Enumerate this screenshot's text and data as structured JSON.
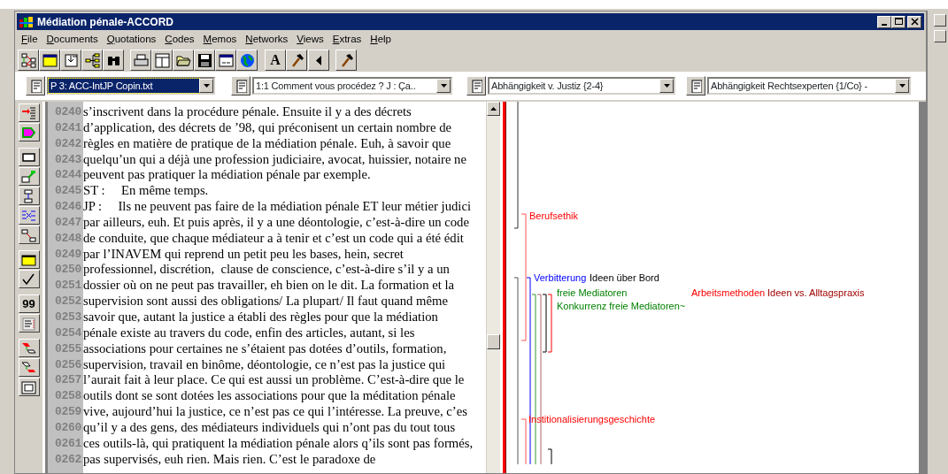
{
  "window": {
    "title": "Médiation pénale-ACCORD"
  },
  "menu": [
    {
      "label": "File"
    },
    {
      "label": "Documents"
    },
    {
      "label": "Quotations"
    },
    {
      "label": "Codes"
    },
    {
      "label": "Memos"
    },
    {
      "label": "Networks"
    },
    {
      "label": "Views"
    },
    {
      "label": "Extras"
    },
    {
      "label": "Help"
    }
  ],
  "toolbar": {
    "font_button": "A"
  },
  "side_toolbar": {
    "quote_button": "99"
  },
  "selectors": [
    {
      "value": "P 3: ACC-IntJP Copin.txt",
      "selected": true
    },
    {
      "value": "1:1 Comment vous procédez ? J : Ça..",
      "selected": false
    },
    {
      "value": "Abhängigkeit v. Justiz {2-4}",
      "selected": false
    },
    {
      "value": "Abhängigkeit Rechtsexperten {1/Co} -",
      "selected": false
    }
  ],
  "lines": [
    {
      "number": "0240",
      "text": "s’inscrivent dans la procédure pénale. Ensuite il y a des décrets"
    },
    {
      "number": "0241",
      "text": "d’application, des décrets de ’98, qui préconisent un certain nombre de"
    },
    {
      "number": "0242",
      "text": "règles en matière de pratique de la médiation pénale. Euh, à savoir que"
    },
    {
      "number": "0243",
      "text": "quelqu’un qui a déjà une profession judiciaire, avocat, huissier, notaire ne"
    },
    {
      "number": "0244",
      "text": "peuvent pas pratiquer la médiation pénale par exemple."
    },
    {
      "number": "0245",
      "text": "ST :     En même temps."
    },
    {
      "number": "0246",
      "text": "JP :     Ils ne peuvent pas faire de la médiation pénale ET leur métier judici"
    },
    {
      "number": "0247",
      "text": "par ailleurs, euh. Et puis après, il y a une déontologie, c’est-à-dire un code"
    },
    {
      "number": "0248",
      "text": "de conduite, que chaque médiateur a à tenir et c’est un code qui a été édit"
    },
    {
      "number": "0249",
      "text": "par l’INAVEM qui reprend un petit peu les bases, hein, secret"
    },
    {
      "number": "0250",
      "text": "professionnel, discrétion,  clause de conscience, c’est-à-dire s’il y a un"
    },
    {
      "number": "0251",
      "text": "dossier où on ne peut pas travailler, eh bien on le dit. La formation et la"
    },
    {
      "number": "0252",
      "text": "supervision sont aussi des obligations/ La plupart/ Il faut quand même"
    },
    {
      "number": "0253",
      "text": "savoir que, autant la justice a établi des règles pour que la médiation"
    },
    {
      "number": "0254",
      "text": "pénale existe au travers du code, enfin des articles, autant, si les"
    },
    {
      "number": "0255",
      "text": "associations pour certaines ne s’étaient pas dotées d’outils, formation,"
    },
    {
      "number": "0256",
      "text": "supervision, travail en binôme, déontologie, ce n’est pas la justice qui"
    },
    {
      "number": "0257",
      "text": "l’aurait fait à leur place. Ce qui est aussi un problème. C’est-à-dire que le"
    },
    {
      "number": "0258",
      "text": "outils dont se sont dotées les associations pour que la méditation pénale"
    },
    {
      "number": "0259",
      "text": "vive, aujourd’hui la justice, ce n’est pas ce qui l’intéresse. La preuve, c’es"
    },
    {
      "number": "0260",
      "text": "qu’il y a des gens, des médiateurs individuels qui n’ont pas du tout tous"
    },
    {
      "number": "0261",
      "text": "ces outils-là, qui pratiquent la médiation pénale alors q’ils sont pas formés,"
    },
    {
      "number": "0262",
      "text": "pas supervisés, euh rien. Mais rien. C’est le paradoxe de"
    }
  ],
  "margin_codes": [
    {
      "label": "Berufsethik",
      "color": "#ff0000"
    },
    {
      "label": "Verbitterung",
      "color": "#0000ff"
    },
    {
      "label": "Ideen über Bord",
      "color": "#000000"
    },
    {
      "label": "freie Mediatoren",
      "color": "#008000"
    },
    {
      "label": "Konkurrenz freie Mediatoren~",
      "color": "#008000"
    },
    {
      "label": "Arbeitsmethoden",
      "color": "#ff0000"
    },
    {
      "label": "Ideen vs. Alltagspraxis",
      "color": "#a00000"
    },
    {
      "label": "Institionalisierungsgeschichte",
      "color": "#ff0000"
    }
  ]
}
